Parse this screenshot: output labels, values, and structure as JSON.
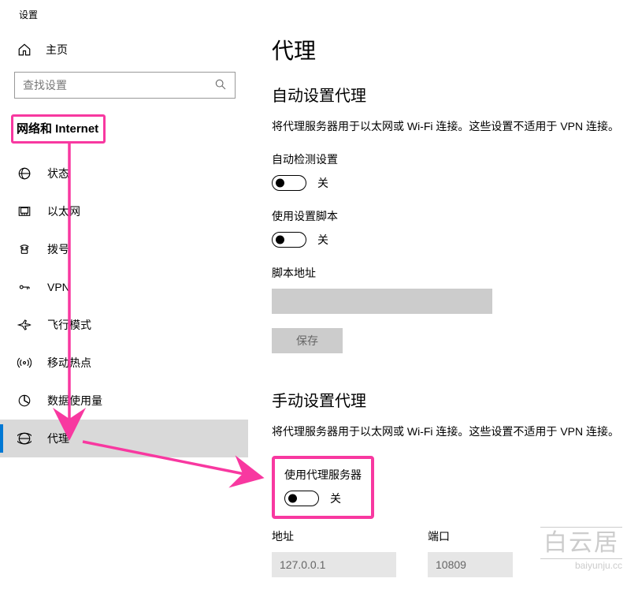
{
  "app_title": "设置",
  "home_label": "主页",
  "search": {
    "placeholder": "查找设置"
  },
  "sidebar": {
    "header": "网络和 Internet",
    "items": [
      {
        "label": "状态",
        "icon": "status"
      },
      {
        "label": "以太网",
        "icon": "ethernet"
      },
      {
        "label": "拨号",
        "icon": "dialup"
      },
      {
        "label": "VPN",
        "icon": "vpn"
      },
      {
        "label": "飞行模式",
        "icon": "airplane"
      },
      {
        "label": "移动热点",
        "icon": "hotspot"
      },
      {
        "label": "数据使用量",
        "icon": "datausage"
      },
      {
        "label": "代理",
        "icon": "proxy"
      }
    ]
  },
  "page": {
    "title": "代理",
    "auto": {
      "title": "自动设置代理",
      "description": "将代理服务器用于以太网或 Wi-Fi 连接。这些设置不适用于 VPN 连接。",
      "detect_label": "自动检测设置",
      "detect_state": "关",
      "script_label": "使用设置脚本",
      "script_state": "关",
      "script_url_label": "脚本地址",
      "script_url_value": "",
      "save_label": "保存"
    },
    "manual": {
      "title": "手动设置代理",
      "description": "将代理服务器用于以太网或 Wi-Fi 连接。这些设置不适用于 VPN 连接。",
      "use_proxy_label": "使用代理服务器",
      "use_proxy_state": "关",
      "address_label": "地址",
      "address_value": "127.0.0.1",
      "port_label": "端口",
      "port_value": "10809"
    }
  },
  "watermark": {
    "name": "白云居",
    "url": "baiyunju.cc"
  }
}
